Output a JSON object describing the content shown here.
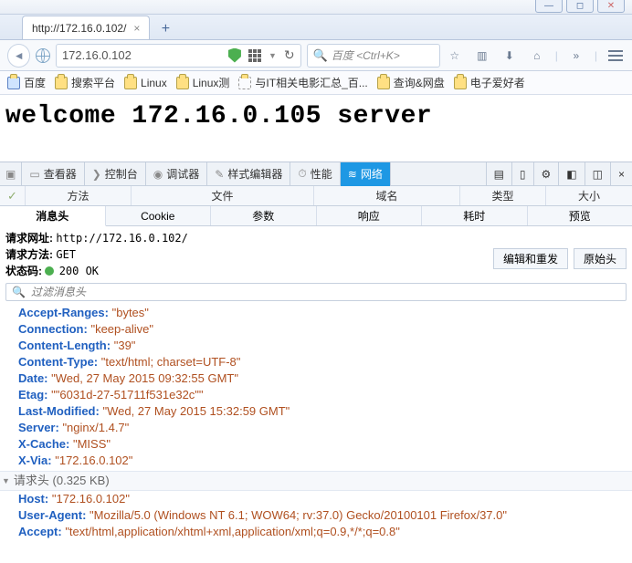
{
  "window": {},
  "tab": {
    "title": "http://172.16.0.102/"
  },
  "nav": {
    "url_display": "172.16.0.102",
    "search_placeholder": "百度 <Ctrl+K>"
  },
  "bookmarks": [
    {
      "label": "百度"
    },
    {
      "label": "搜索平台"
    },
    {
      "label": "Linux"
    },
    {
      "label": "Linux测"
    },
    {
      "label": "与IT相关电影汇总_百..."
    },
    {
      "label": "查询&网盘"
    },
    {
      "label": "电子爱好者"
    }
  ],
  "page": {
    "heading": "welcome 172.16.0.105 server"
  },
  "devtools": {
    "tabs": {
      "inspector": "查看器",
      "console": "控制台",
      "debugger": "调试器",
      "style": "样式编辑器",
      "perf": "性能",
      "network": "网络"
    },
    "columns": {
      "method": "方法",
      "file": "文件",
      "domain": "域名",
      "type": "类型",
      "size": "大小"
    },
    "req_tabs": {
      "headers": "消息头",
      "cookies": "Cookie",
      "params": "参数",
      "response": "响应",
      "timing": "耗时",
      "preview": "预览"
    },
    "summary": {
      "url_label": "请求网址:",
      "url_value": "http://172.16.0.102/",
      "method_label": "请求方法:",
      "method_value": "GET",
      "status_label": "状态码:",
      "status_value": "200 OK",
      "edit_resend": "编辑和重发",
      "raw_headers": "原始头"
    },
    "filter_placeholder": "过滤消息头",
    "response_headers": [
      {
        "k": "Accept-Ranges",
        "v": "\"bytes\""
      },
      {
        "k": "Connection",
        "v": "\"keep-alive\""
      },
      {
        "k": "Content-Length",
        "v": "\"39\""
      },
      {
        "k": "Content-Type",
        "v": "\"text/html; charset=UTF-8\""
      },
      {
        "k": "Date",
        "v": "\"Wed, 27 May 2015 09:32:55 GMT\""
      },
      {
        "k": "Etag",
        "v": "\"\"6031d-27-51711f531e32c\"\""
      },
      {
        "k": "Last-Modified",
        "v": "\"Wed, 27 May 2015 15:32:59 GMT\""
      },
      {
        "k": "Server",
        "v": "\"nginx/1.4.7\""
      },
      {
        "k": "X-Cache",
        "v": "\"MISS\""
      },
      {
        "k": "X-Via",
        "v": "\"172.16.0.102\""
      }
    ],
    "request_section_label": "请求头 (0.325 KB)",
    "request_headers": [
      {
        "k": "Host",
        "v": "\"172.16.0.102\""
      },
      {
        "k": "User-Agent",
        "v": "\"Mozilla/5.0 (Windows NT 6.1; WOW64; rv:37.0) Gecko/20100101 Firefox/37.0\""
      },
      {
        "k": "Accept",
        "v": "\"text/html,application/xhtml+xml,application/xml;q=0.9,*/*;q=0.8\""
      }
    ]
  }
}
